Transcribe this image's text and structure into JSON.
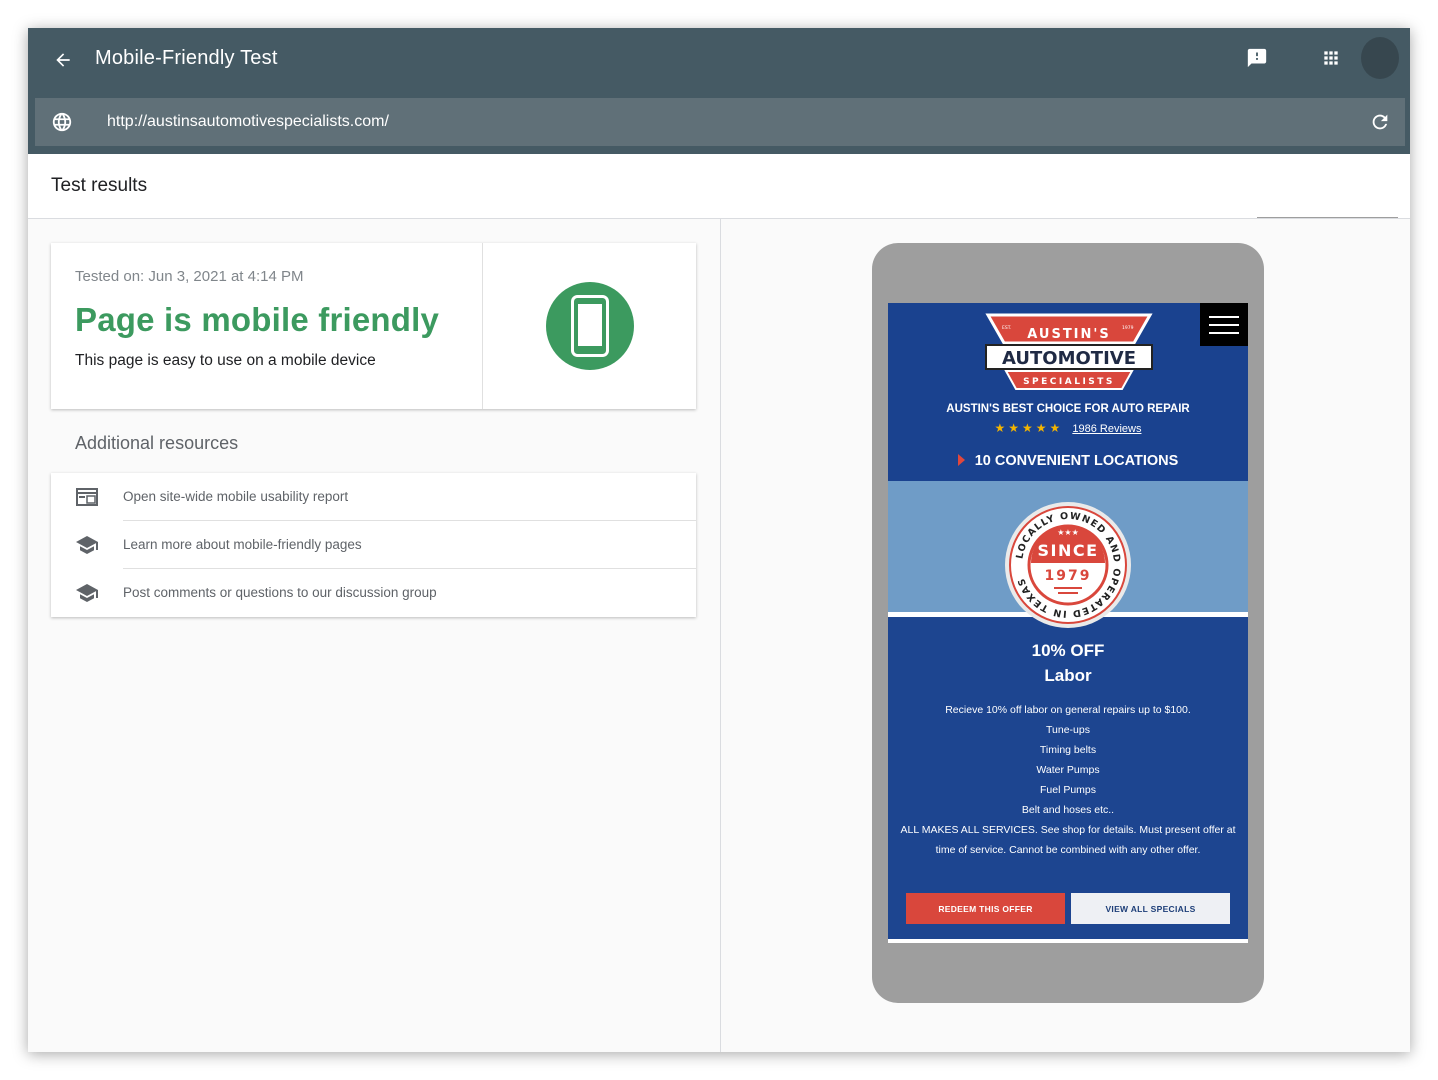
{
  "app": {
    "title": "Mobile-Friendly Test",
    "back_icon": "arrow-back-icon",
    "feedback_icon": "feedback-icon",
    "apps_icon": "apps-grid-icon"
  },
  "url_bar": {
    "value": "http://austinsautomotivespecialists.com/",
    "globe_icon": "globe-icon",
    "reload_icon": "reload-icon"
  },
  "results": {
    "header": "Test results",
    "tested_on": "Tested on: Jun 3, 2021 at 4:14 PM",
    "status_title": "Page is mobile friendly",
    "status_desc": "This page is easy to use on a mobile device",
    "status_color": "#3c9a5f"
  },
  "resources": {
    "title": "Additional resources",
    "items": [
      {
        "label": "Open site-wide mobile usability report",
        "icon": "web-report-icon"
      },
      {
        "label": "Learn more about mobile-friendly pages",
        "icon": "school-icon"
      },
      {
        "label": "Post comments or questions to our discussion group",
        "icon": "school-icon"
      }
    ]
  },
  "preview": {
    "logo": {
      "est": "EST.",
      "year": "1979",
      "line1": "AUSTIN'S",
      "line2": "AUTOMOTIVE",
      "line3": "SPECIALISTS"
    },
    "best_choice": "AUSTIN'S BEST CHOICE FOR AUTO REPAIR",
    "stars": "★★★★★",
    "reviews": "1986 Reviews",
    "locations": "10 CONVENIENT LOCATIONS",
    "badge": {
      "arc_text": "LOCALLY OWNED AND OPERATED IN TEXAS",
      "since": "SINCE",
      "year": "1979",
      "mini_stars": "★★★"
    },
    "offer_title": "10% OFF",
    "offer_sub": "Labor",
    "offer_lines": [
      "Recieve 10% off labor on general repairs up to $100.",
      "Tune-ups",
      "Timing belts",
      "Water Pumps",
      "Fuel Pumps",
      "Belt and hoses etc..",
      "ALL MAKES ALL SERVICES. See shop for details. Must present offer at time of service. Cannot be combined with any other offer."
    ],
    "cta_redeem": "REDEEM THIS OFFER",
    "cta_specials": "VIEW ALL SPECIALS",
    "colors": {
      "brand_blue": "#1a428f",
      "accent_red": "#d9473c",
      "light_blue": "#6f9cc7"
    }
  }
}
